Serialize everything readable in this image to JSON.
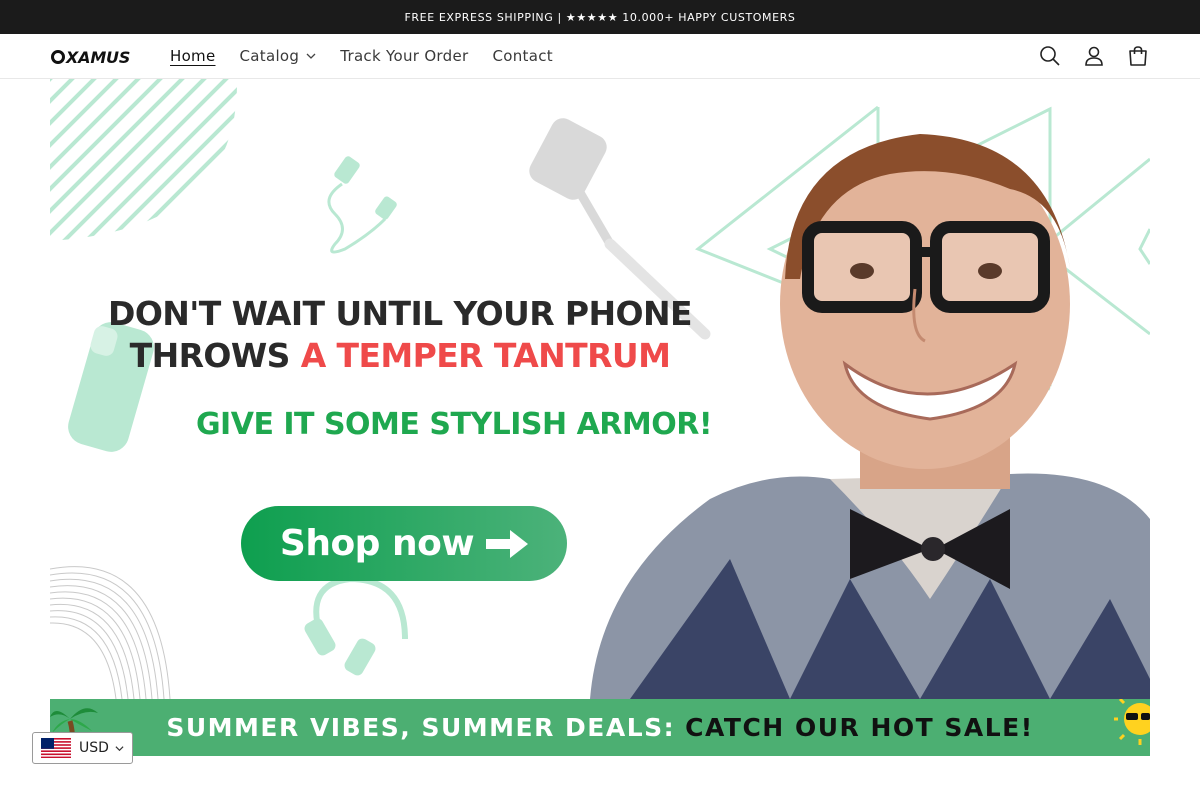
{
  "announcement": {
    "text": "FREE EXPRESS SHIPPING | ★★★★★ 10.000+ HAPPY CUSTOMERS"
  },
  "header": {
    "logo_text": "XAMUS",
    "nav": [
      {
        "label": "Home",
        "active": true
      },
      {
        "label": "Catalog",
        "has_dropdown": true
      },
      {
        "label": "Track Your Order"
      },
      {
        "label": "Contact"
      }
    ],
    "icons": [
      "search-icon",
      "account-icon",
      "cart-icon"
    ]
  },
  "hero": {
    "headline_line1": "DON'T WAIT UNTIL YOUR PHONE",
    "headline_line2_prefix": "THROWS ",
    "headline_line2_accent": "A TEMPER TANTRUM",
    "subheadline": "GIVE IT SOME STYLISH ARMOR!",
    "cta_label": "Shop now",
    "colors": {
      "accent_red": "#ef4a4a",
      "accent_green": "#1fa84f",
      "decor_mint": "#b9e8d2"
    }
  },
  "banner": {
    "part1": "SUMMER VIBES, SUMMER DEALS:",
    "part2": "CATCH OUR HOT SALE!",
    "background": "#4caf72"
  },
  "currency": {
    "code": "USD",
    "flag": "us-flag-icon"
  }
}
